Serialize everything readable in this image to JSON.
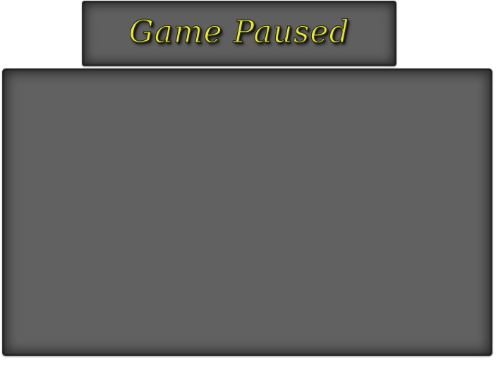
{
  "pause_menu": {
    "title": "Game Paused",
    "title_color": "#e6e63a",
    "panel_color": "#616161"
  }
}
